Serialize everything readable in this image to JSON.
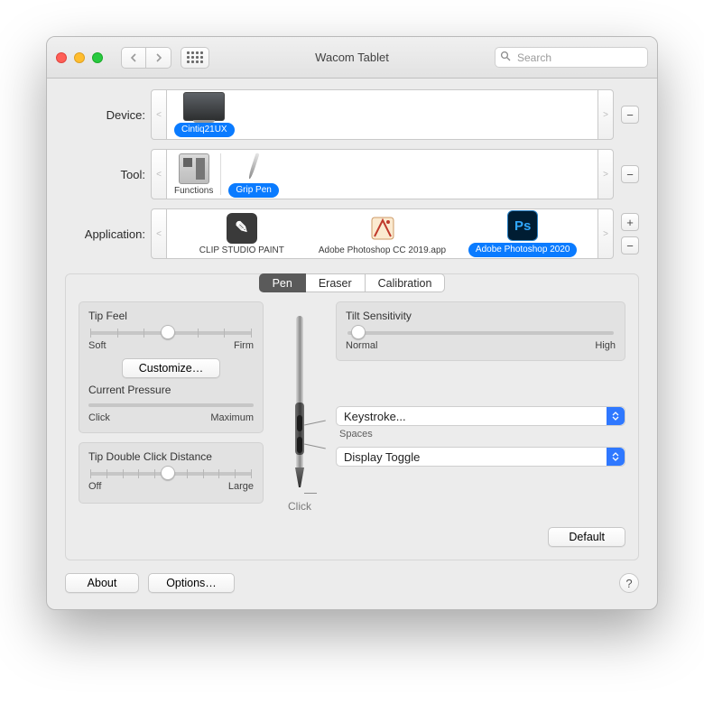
{
  "window": {
    "title": "Wacom Tablet"
  },
  "search": {
    "placeholder": "Search"
  },
  "rows": {
    "device": {
      "label": "Device:",
      "item_label": "Cintiq21UX"
    },
    "tool": {
      "label": "Tool:",
      "functions_label": "Functions",
      "pen_label": "Grip Pen"
    },
    "application": {
      "label": "Application:",
      "items": [
        {
          "label": "CLIP STUDIO PAINT"
        },
        {
          "label": "Adobe Photoshop CC 2019.app"
        },
        {
          "label": "Adobe Photoshop 2020"
        }
      ]
    }
  },
  "tabs": {
    "pen": "Pen",
    "eraser": "Eraser",
    "calibration": "Calibration",
    "active": "pen"
  },
  "tipfeel": {
    "title": "Tip Feel",
    "min": "Soft",
    "max": "Firm",
    "customize": "Customize…",
    "value_pct": 48
  },
  "pressure": {
    "title": "Current Pressure",
    "min": "Click",
    "max": "Maximum"
  },
  "doubleclick": {
    "title": "Tip Double Click Distance",
    "min": "Off",
    "max": "Large",
    "value_pct": 48
  },
  "tilt": {
    "title": "Tilt Sensitivity",
    "min": "Normal",
    "max": "High",
    "value_pct": 4
  },
  "pen": {
    "click_label": "Click",
    "upper": {
      "label": "Keystroke...",
      "sub": "Spaces"
    },
    "lower": {
      "label": "Display Toggle"
    }
  },
  "buttons": {
    "default": "Default",
    "about": "About",
    "options": "Options…"
  }
}
